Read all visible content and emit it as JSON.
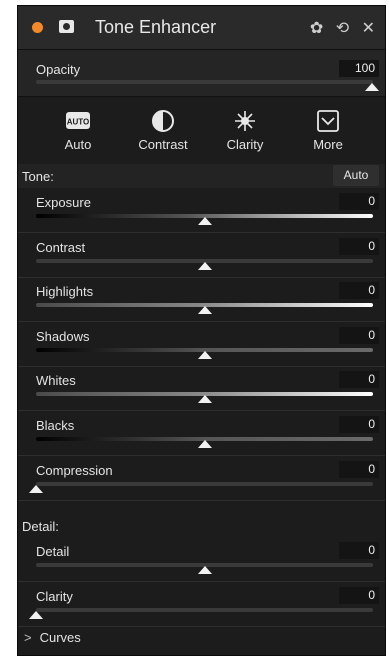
{
  "panel": {
    "title": "Tone Enhancer",
    "settings_icon": "gear-icon",
    "reset_icon": "undo-icon",
    "close_icon": "close-icon",
    "accent_color": "#f08a2c"
  },
  "opacity": {
    "label": "Opacity",
    "value": "100",
    "level": 1.0
  },
  "presets": [
    {
      "label": "Auto",
      "icon": "auto-icon",
      "glyph": "AUTO"
    },
    {
      "label": "Contrast",
      "icon": "contrast-icon"
    },
    {
      "label": "Clarity",
      "icon": "clarity-icon"
    },
    {
      "label": "More",
      "icon": "chevron-down-box-icon"
    }
  ],
  "tone": {
    "heading": "Tone:",
    "auto_label": "Auto",
    "sliders": [
      {
        "label": "Exposure",
        "value": "0",
        "level": 0.5,
        "gradient": "dark-light"
      },
      {
        "label": "Contrast",
        "value": "0",
        "level": 0.5,
        "gradient": "flat"
      },
      {
        "label": "Highlights",
        "value": "0",
        "level": 0.5,
        "gradient": "gray-white"
      },
      {
        "label": "Shadows",
        "value": "0",
        "level": 0.5,
        "gradient": "dark-gray"
      },
      {
        "label": "Whites",
        "value": "0",
        "level": 0.5,
        "gradient": "gray-white"
      },
      {
        "label": "Blacks",
        "value": "0",
        "level": 0.5,
        "gradient": "dark-gray"
      },
      {
        "label": "Compression",
        "value": "0",
        "level": 0.0,
        "gradient": "flat"
      }
    ]
  },
  "detail": {
    "heading": "Detail:",
    "sliders": [
      {
        "label": "Detail",
        "value": "0",
        "level": 0.5,
        "gradient": "flat"
      },
      {
        "label": "Clarity",
        "value": "0",
        "level": 0.0,
        "gradient": "flat"
      }
    ]
  },
  "curves": {
    "chevron": ">",
    "label": "Curves"
  }
}
